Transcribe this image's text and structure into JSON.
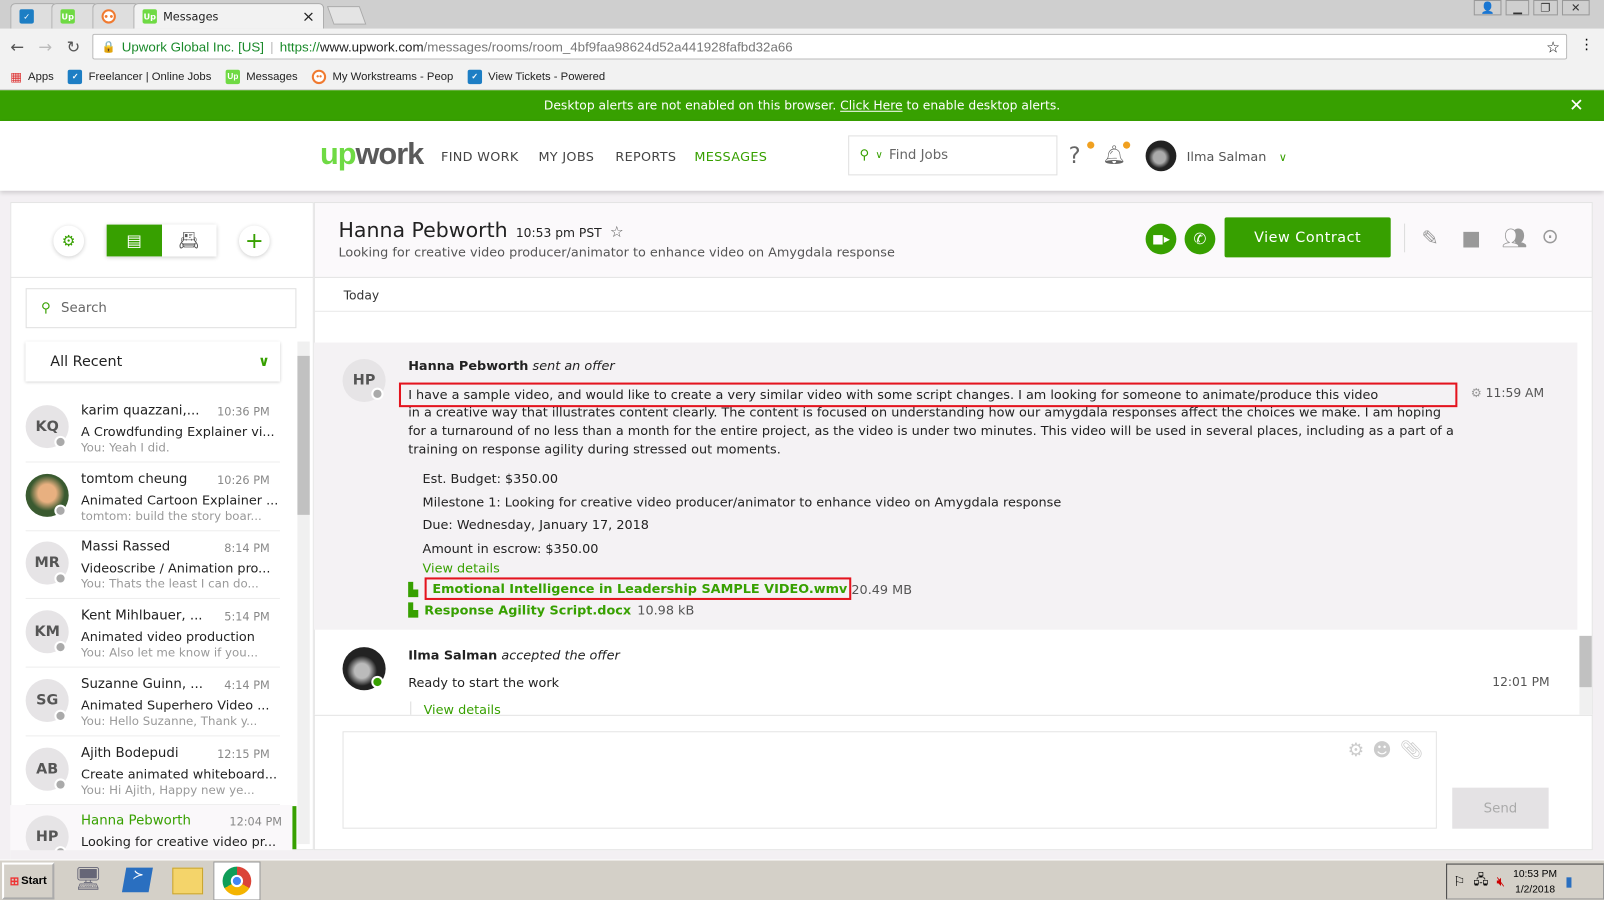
{
  "browser": {
    "tabs": [
      {
        "icon": "freelancer-icon",
        "title": ""
      },
      {
        "icon": "upwork-icon",
        "title": ""
      },
      {
        "icon": "workstreams-icon",
        "title": ""
      },
      {
        "icon": "upwork-icon",
        "title": "Messages",
        "active": true
      }
    ],
    "close": "×",
    "security_label": "Upwork Global Inc. [US]",
    "url_scheme": "https://",
    "url_host": "www.upwork.com",
    "url_path": "/messages/rooms/room_4bf9faa98624d52a441928fafbd32a66",
    "bookmarks": [
      "Apps",
      "Freelancer | Online Jobs",
      "Messages",
      "My Workstreams - Peop",
      "View Tickets - Powered"
    ]
  },
  "banner": {
    "text_before": "Desktop alerts are not enabled on this browser. ",
    "link": "Click Here",
    "text_after": " to enable desktop alerts."
  },
  "nav": {
    "logo": "upwork",
    "links": [
      "FIND WORK",
      "MY JOBS",
      "REPORTS",
      "MESSAGES"
    ],
    "active": "MESSAGES",
    "search_placeholder": "Find Jobs",
    "user": "Ilma Salman",
    "accent": "#37a000",
    "badge_color": "#f0a020"
  },
  "sidebar": {
    "search_placeholder": "Search",
    "filter": "All Recent",
    "rooms": [
      {
        "initials": "KQ",
        "name": "karim quazzani,...",
        "time": "10:36 PM",
        "subject": "A Crowdfunding Explainer vi...",
        "preview": "You: Yeah I did."
      },
      {
        "initials": "",
        "name": "tomtom cheung",
        "time": "10:26 PM",
        "subject": "Animated Cartoon Explainer ...",
        "preview": "tomtom: build the story boar..."
      },
      {
        "initials": "MR",
        "name": "Massi Rassed",
        "time": "8:14 PM",
        "subject": "Videoscribe / Animation pro...",
        "preview": "You: Thats the least I can do..."
      },
      {
        "initials": "KM",
        "name": "Kent Mihlbauer, ...",
        "time": "5:14 PM",
        "subject": "Animated video production",
        "preview": "You: Also let me know if you..."
      },
      {
        "initials": "SG",
        "name": "Suzanne Guinn, ...",
        "time": "4:14 PM",
        "subject": "Animated Superhero Video ...",
        "preview": "You: Hello Suzanne, Thank y..."
      },
      {
        "initials": "AB",
        "name": "Ajith Bodepudi",
        "time": "12:15 PM",
        "subject": "Create animated whiteboard...",
        "preview": "You: Hi Ajith, Happy new ye..."
      },
      {
        "initials": "HP",
        "name": "Hanna Pebworth",
        "time": "12:04 PM",
        "subject": "Looking for creative video pr...",
        "preview": "",
        "active": true
      }
    ]
  },
  "room": {
    "name": "Hanna Pebworth",
    "local_time": "10:53 pm PST",
    "subtitle": "Looking for creative video producer/animator to enhance video on Amygdala response",
    "view_contract": "View Contract",
    "day": "Today",
    "messages": [
      {
        "initials": "HP",
        "sender": "Hanna Pebworth",
        "action": "sent an offer",
        "time": "11:59 AM",
        "first_line": "I have a sample video, and would like to create a very similar video with some script changes. I am looking for someone to animate/produce this video",
        "rest": "in a creative way that illustrates content clearly. The content is focused on understanding how our amygdala responses affect the choices we make. I am hoping for a turnaround of no less than a month for the entire project, as the video is under two minutes. This video will be used in several places, including as a part of a training on response agility during stressed out moments.",
        "details": [
          "Est. Budget: $350.00",
          "Milestone 1: Looking for creative video producer/animator to enhance video on Amygdala response",
          "Due: Wednesday, January 17, 2018",
          "Amount in escrow: $350.00"
        ],
        "view_details": "View details",
        "files": [
          {
            "name": "Emotional Intelligence in Leadership SAMPLE VIDEO.wmv",
            "size": "20.49 MB"
          },
          {
            "name": "Response Agility Script.docx",
            "size": "10.98 kB"
          }
        ]
      },
      {
        "sender": "Ilma Salman",
        "action": "accepted the offer",
        "time": "12:01 PM",
        "text": "Ready to start the work",
        "view_details": "View details"
      }
    ],
    "send": "Send"
  },
  "taskbar": {
    "start": "Start",
    "time": "10:53 PM",
    "date": "1/2/2018"
  }
}
